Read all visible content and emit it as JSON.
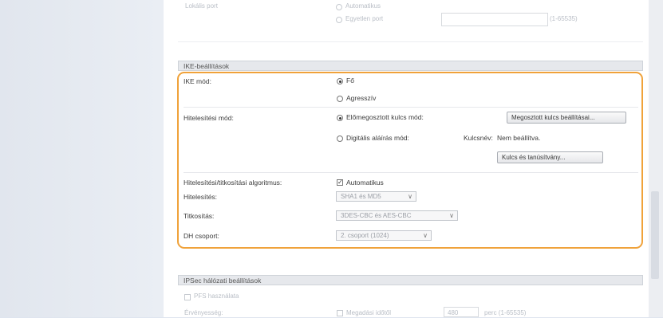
{
  "top_faded": {
    "row1_label": "Lokális port",
    "row1_option": "Automatikus",
    "single_port_option": "Egyetlen port",
    "port_range_hint": "(1-65535)"
  },
  "ike_section": {
    "title": "IKE-beállítások",
    "ike_mode": {
      "label": "IKE mód:",
      "options": [
        "Fő",
        "Agresszív"
      ],
      "selected": "Fő"
    },
    "auth_method": {
      "label": "Hitelesítési mód:",
      "psk_option": "Előmegosztott kulcs mód:",
      "psk_button": "Megosztott kulcs beállításai...",
      "sig_option": "Digitális aláírás mód:",
      "key_name_label": "Kulcsnév:",
      "key_name_value": "Nem beállítva.",
      "key_cert_button": "Kulcs és tanúsítvány..."
    },
    "algorithm": {
      "label": "Hitelesítési/titkosítási algoritmus:",
      "auto_label": "Automatikus",
      "auto_checked": true
    },
    "authentication": {
      "label": "Hitelesítés:",
      "value": "SHA1 és MD5"
    },
    "encryption": {
      "label": "Titkosítás:",
      "value": "3DES-CBC és AES-CBC"
    },
    "dh_group": {
      "label": "DH csoport:",
      "value": "2. csoport (1024)"
    }
  },
  "ipsec_section": {
    "title": "IPSec hálózati beállítások",
    "pfs_label": "PFS használata",
    "validity_label": "Érvényesség:",
    "time_label": "Megadási időtől",
    "time_value": "480",
    "time_range": "perc (1-65535)"
  }
}
